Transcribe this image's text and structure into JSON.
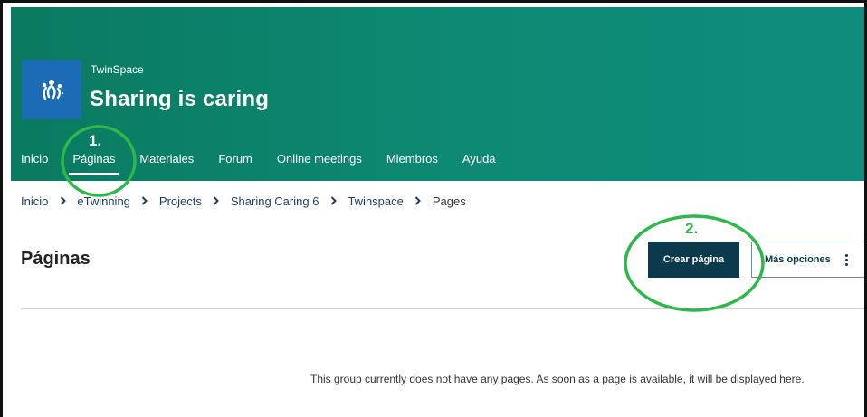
{
  "header": {
    "site_label": "TwinSpace",
    "title": "Sharing is caring",
    "logo_icon": "twinspace-logo-icon"
  },
  "nav": {
    "items": [
      {
        "label": "Inicio"
      },
      {
        "label": "Páginas",
        "active": true
      },
      {
        "label": "Materiales"
      },
      {
        "label": "Forum"
      },
      {
        "label": "Online meetings"
      },
      {
        "label": "Miembros"
      },
      {
        "label": "Ayuda"
      }
    ]
  },
  "breadcrumb": {
    "items": [
      "Inicio",
      "eTwinning",
      "Projects",
      "Sharing Caring 6",
      "Twinspace",
      "Pages"
    ],
    "separator": "›"
  },
  "page": {
    "title": "Páginas",
    "create_button": "Crear página",
    "more_button": "Más opciones",
    "empty_message": "This group currently does not have any pages. As soon as a page is available, it will be displayed here."
  },
  "annotations": {
    "step1": "1.",
    "step2": "2.",
    "color": "#2db84a"
  },
  "colors": {
    "header_bg": "#0e8a74",
    "logo_bg": "#1b6cb5",
    "primary_button": "#0b3a4c",
    "breadcrumb_link": "#1f3f66"
  }
}
